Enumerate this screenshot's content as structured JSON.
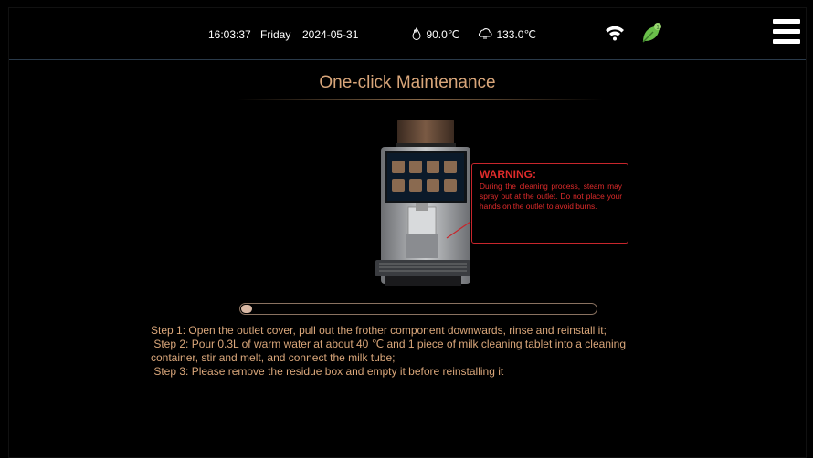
{
  "status_bar": {
    "time": "16:03:37",
    "day": "Friday",
    "date": "2024-05-31",
    "water_temp": "90.0℃",
    "steam_temp": "133.0℃",
    "leaf_badge": "1"
  },
  "page": {
    "title": "One-click Maintenance"
  },
  "warning": {
    "heading": "WARNING:",
    "body": "During the cleaning process, steam may spray out at the outlet. Do not place your hands on the outlet to avoid burns."
  },
  "progress": {
    "value": 0.03
  },
  "steps": [
    "Step 1: Open the outlet cover, pull out the frother component downwards, rinse and reinstall it;",
    " Step 2: Pour 0.3L of warm water at about 40 ℃ and 1 piece of milk cleaning tablet into a cleaning",
    "container, stir and melt, and connect the milk tube;",
    " Step 3: Please remove the residue box and empty it before reinstalling it"
  ],
  "colors": {
    "accent": "#d9a67a",
    "warning": "#e02b2b",
    "leaf": "#6ac04a"
  },
  "icons": [
    "water-drop-icon",
    "steam-icon",
    "wifi-icon",
    "leaf-icon",
    "menu-icon"
  ]
}
